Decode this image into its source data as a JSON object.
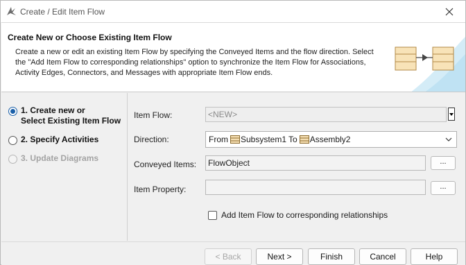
{
  "window": {
    "title": "Create / Edit Item Flow",
    "close_icon": "close-icon"
  },
  "header": {
    "title": "Create New or Choose Existing Item Flow",
    "description": "Create a new or edit an existing Item Flow by specifying the Conveyed Items and the flow direction. Select the \"Add Item Flow to corresponding relationships\" option to synchronize the Item Flow for Associations, Activity Edges, Connectors, and Messages with appropriate Item Flow ends."
  },
  "steps": [
    {
      "label": "1. Create new or Select Existing Item Flow",
      "line1": "1. Create new or",
      "line2": "Select Existing Item Flow",
      "state": "selected"
    },
    {
      "label": "2. Specify Activities",
      "state": "enabled"
    },
    {
      "label": "3. Update Diagrams",
      "state": "disabled"
    }
  ],
  "form": {
    "item_flow": {
      "label": "Item Flow:",
      "value": "<NEW>"
    },
    "direction": {
      "label": "Direction:",
      "from_word": "From",
      "from_value": "Subsystem1",
      "to_word": "To",
      "to_value": "Assembly2"
    },
    "conveyed_items": {
      "label": "Conveyed Items:",
      "value": "FlowObject",
      "button": "..."
    },
    "item_property": {
      "label": "Item Property:",
      "value": "",
      "button": "..."
    },
    "add_item_flow_checkbox": {
      "label": "Add Item Flow to corresponding relationships",
      "checked": false
    }
  },
  "buttons": {
    "back": "< Back",
    "next": "Next >",
    "finish": "Finish",
    "cancel": "Cancel",
    "help": "Help"
  },
  "colors": {
    "accent": "#1a5fa8",
    "class_icon_fill": "#f5deb3",
    "class_icon_border": "#8b6a2b"
  }
}
